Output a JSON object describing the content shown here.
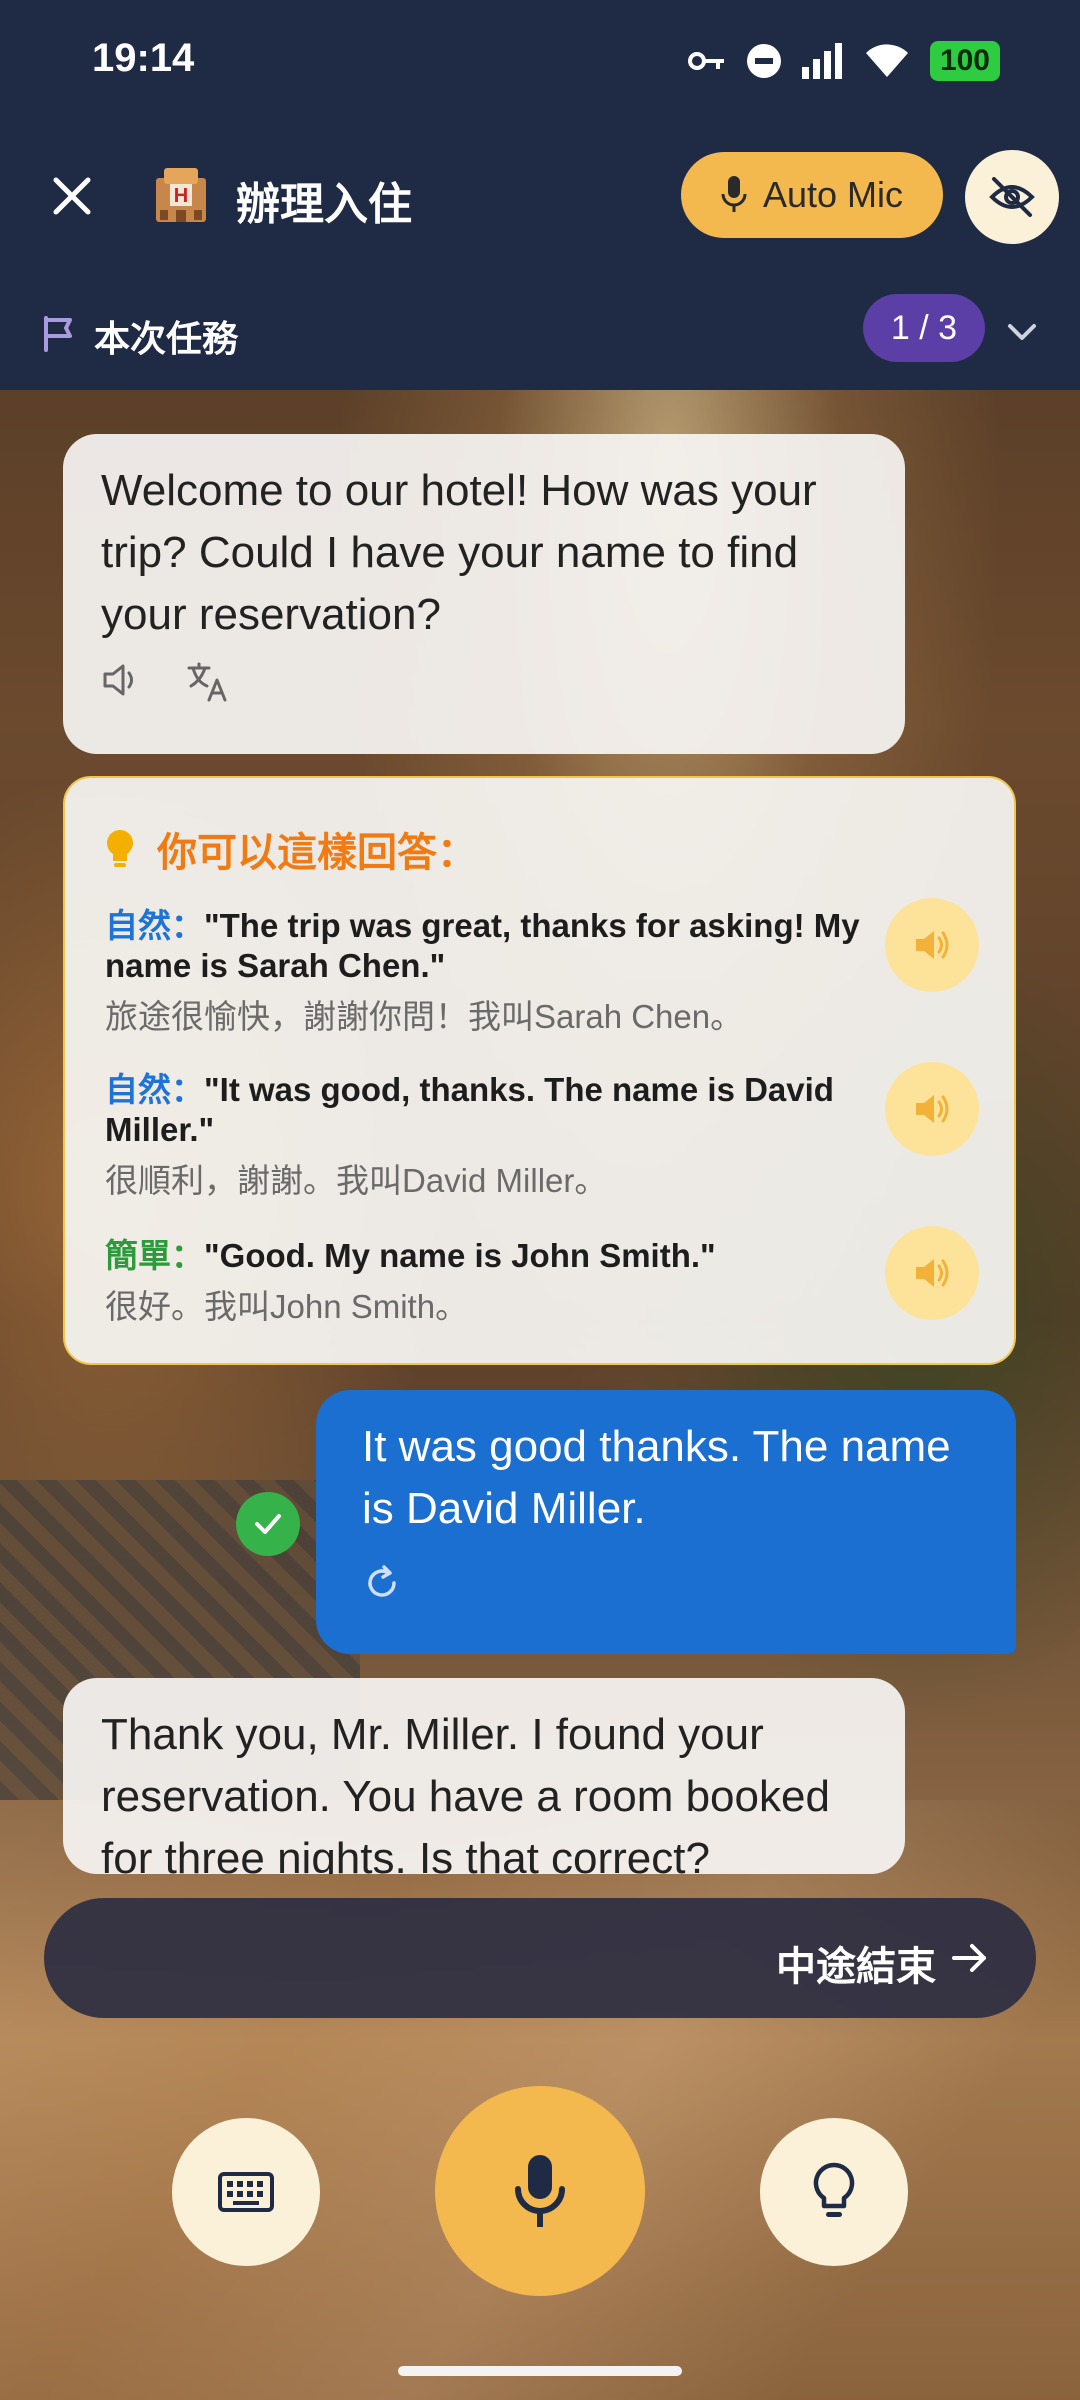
{
  "status_bar": {
    "time": "19:14",
    "battery": "100",
    "icons": [
      "vpn-key-icon",
      "do-not-disturb-icon",
      "signal-icon",
      "wifi-icon",
      "battery-icon"
    ]
  },
  "header": {
    "title": "辦理入住",
    "auto_mic_label": "Auto Mic",
    "task_label": "本次任務",
    "task_counter": "1 / 3"
  },
  "chat": {
    "ai_message_1": "Welcome to our hotel! How was your trip? Could I have your name to find your reservation?",
    "suggestions": {
      "title": "你可以這樣回答：",
      "items": [
        {
          "tag": "自然：",
          "tag_color": "#1e73d8",
          "english": "\"The trip was great, thanks for asking! My name is Sarah Chen.\"",
          "chinese": "旅途很愉快，謝謝你問！我叫Sarah Chen。"
        },
        {
          "tag": "自然：",
          "tag_color": "#1e73d8",
          "english": "\"It was good, thanks. The name is David Miller.\"",
          "chinese": "很順利，謝謝。我叫David Miller。"
        },
        {
          "tag": "簡單：",
          "tag_color": "#2c9b3c",
          "english": "\"Good. My name is John Smith.\"",
          "chinese": "很好。我叫John Smith。"
        }
      ]
    },
    "user_message": "It was good thanks. The name is David Miller.",
    "ai_message_2": "Thank you, Mr. Miller. I found your reservation. You have a room booked for three nights. Is that correct?"
  },
  "footer": {
    "end_label": "中途結束"
  },
  "colors": {
    "header_bg": "#1f2a44",
    "accent_yellow": "#f4b94e",
    "user_bubble": "#1a6fd0",
    "suggestion_title": "#f07b14",
    "task_counter_bg": "#5b3fa6"
  }
}
